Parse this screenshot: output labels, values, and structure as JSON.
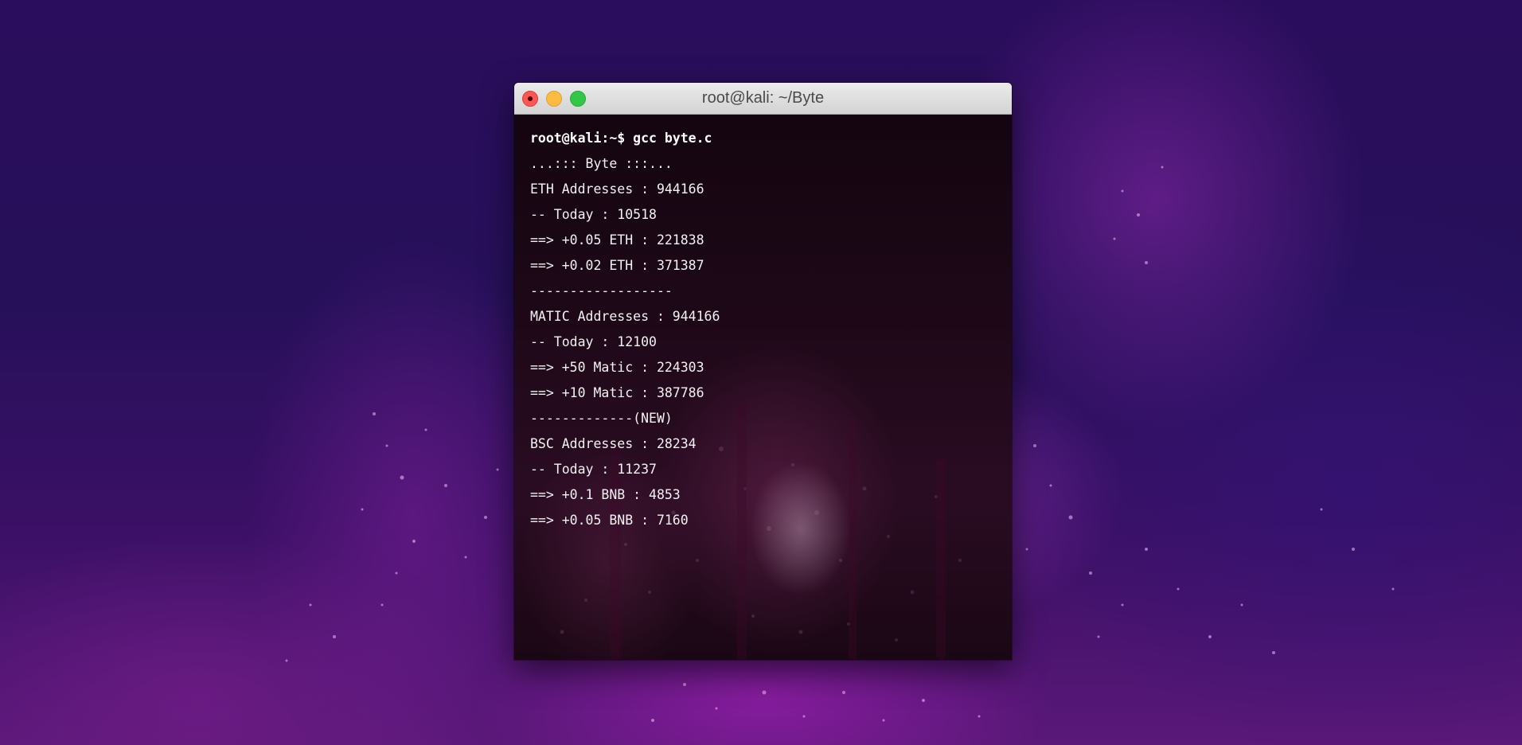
{
  "window": {
    "title": "root@kali: ~/Byte"
  },
  "terminal": {
    "lines": [
      "root@kali:~$ gcc byte.c",
      "...::: Byte :::...",
      "ETH Addresses : 944166",
      "-- Today : 10518",
      "==> +0.05 ETH : 221838",
      "==> +0.02 ETH : 371387",
      "------------------",
      "MATIC Addresses : 944166",
      "-- Today : 12100",
      "==> +50 Matic : 224303",
      "==> +10 Matic : 387786",
      "-------------(NEW)",
      "BSC Addresses : 28234",
      "-- Today : 11237",
      "==> +0.1 BNB : 4853",
      "==> +0.05 BNB : 7160"
    ]
  },
  "colors": {
    "close": "#fc5753",
    "minimize": "#fdbc40",
    "zoom": "#33c748",
    "terminal_text": "#f2f2f2"
  }
}
